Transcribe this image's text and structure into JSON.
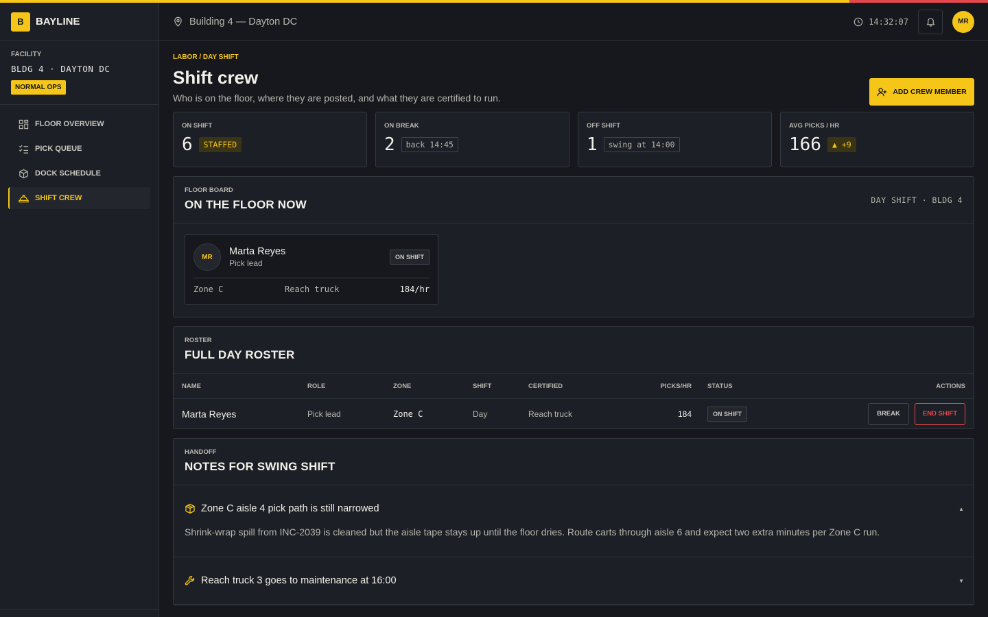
{
  "brand": {
    "logo": "B",
    "name": "BAYLINE"
  },
  "facility": {
    "label": "FACILITY",
    "name": "BLDG 4 · DAYTON DC",
    "badge": "NORMAL OPS"
  },
  "nav": [
    {
      "label": "FLOOR OVERVIEW",
      "icon": "grid-icon",
      "active": false
    },
    {
      "label": "PICK QUEUE",
      "icon": "checklist-icon",
      "active": false
    },
    {
      "label": "DOCK SCHEDULE",
      "icon": "box-icon",
      "active": false
    },
    {
      "label": "SHIFT CREW",
      "icon": "hardhat-icon",
      "active": true
    }
  ],
  "header": {
    "location": "Building 4 — Dayton DC",
    "clock": "14:32:07",
    "avatar": "MR"
  },
  "page": {
    "crumb": "LABOR / DAY SHIFT",
    "title": "Shift crew",
    "subtitle": "Who is on the floor, where they are posted, and what they are certified to run.",
    "add_button": "ADD CREW MEMBER"
  },
  "stats": [
    {
      "label": "ON SHIFT",
      "value": "6",
      "chip": "STAFFED"
    },
    {
      "label": "ON BREAK",
      "value": "2",
      "chip": "back 14:45"
    },
    {
      "label": "OFF SHIFT",
      "value": "1",
      "chip": "swing at 14:00"
    },
    {
      "label": "AVG PICKS / HR",
      "value": "166",
      "chip": "▲ +9"
    }
  ],
  "floor": {
    "eyebrow": "FLOOR BOARD",
    "title": "ON THE FLOOR NOW",
    "meta": "DAY SHIFT · BLDG 4",
    "card": {
      "initials": "MR",
      "name": "Marta Reyes",
      "role": "Pick lead",
      "status": "ON SHIFT",
      "zone": "Zone C",
      "equipment": "Reach truck",
      "rate": "184/hr"
    }
  },
  "roster": {
    "eyebrow": "ROSTER",
    "title": "FULL DAY ROSTER",
    "columns": [
      "NAME",
      "ROLE",
      "ZONE",
      "SHIFT",
      "CERTIFIED",
      "PICKS/HR",
      "STATUS",
      "ACTIONS"
    ],
    "rows": [
      {
        "name": "Marta Reyes",
        "role": "Pick lead",
        "zone": "Zone C",
        "shift": "Day",
        "certified": "Reach truck",
        "picks": "184",
        "status": "ON SHIFT",
        "break_label": "BREAK",
        "end_label": "END SHIFT"
      }
    ]
  },
  "handoff": {
    "eyebrow": "HANDOFF",
    "title": "NOTES FOR SWING SHIFT",
    "notes": [
      {
        "title": "Zone C aisle 4 pick path is still narrowed",
        "body": "Shrink-wrap spill from INC-2039 is cleaned but the aisle tape stays up until the floor dries. Route carts through aisle 6 and expect two extra minutes per Zone C run.",
        "caret": "▲",
        "icon": "box-icon"
      },
      {
        "title": "Reach truck 3 goes to maintenance at 16:00",
        "caret": "▼",
        "icon": "wrench-icon"
      }
    ]
  },
  "colors": {
    "accent": "#f5c518",
    "danger": "#e2484d",
    "background": "#16181d"
  }
}
